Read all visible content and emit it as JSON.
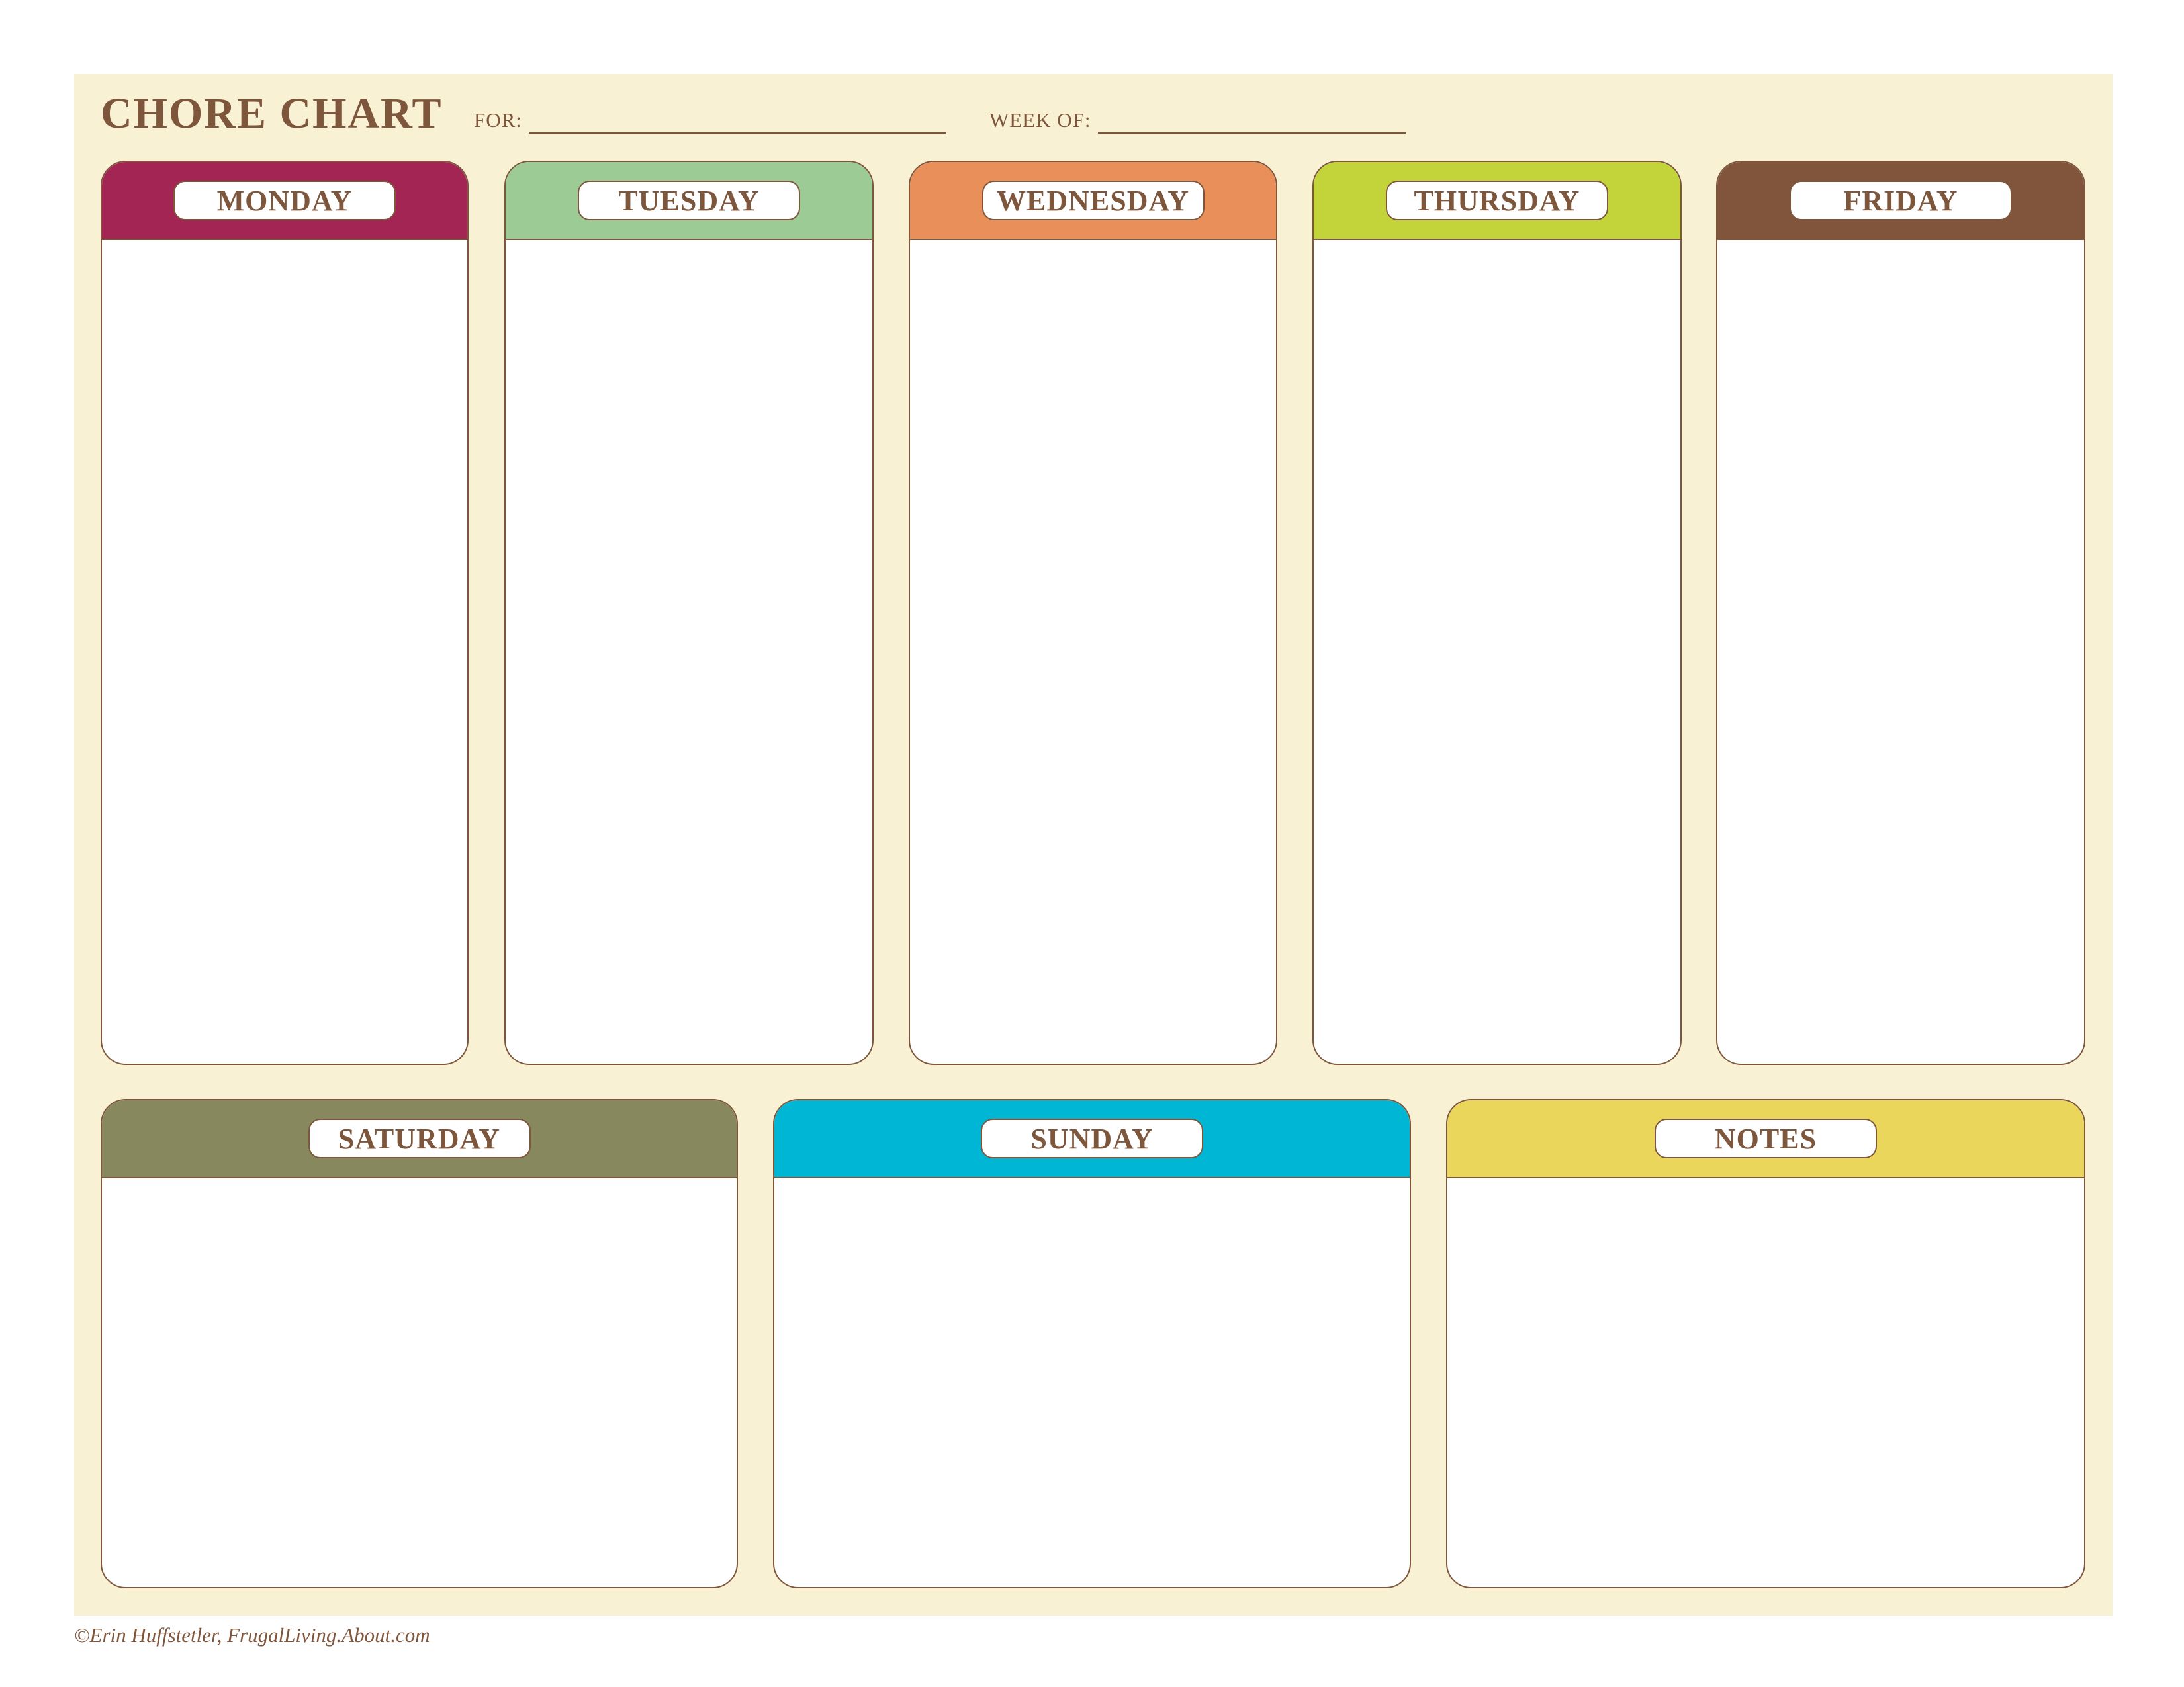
{
  "header": {
    "title": "CHORE CHART",
    "for_label": "FOR:",
    "week_of_label": "WEEK OF:"
  },
  "days": [
    {
      "label": "MONDAY",
      "color": "#a32553"
    },
    {
      "label": "TUESDAY",
      "color": "#9ccb96"
    },
    {
      "label": "WEDNESDAY",
      "color": "#e98f5a"
    },
    {
      "label": "THURSDAY",
      "color": "#c3d43b"
    },
    {
      "label": "FRIDAY",
      "color": "#81543c"
    },
    {
      "label": "SATURDAY",
      "color": "#87885d"
    },
    {
      "label": "SUNDAY",
      "color": "#00b6d5"
    },
    {
      "label": "NOTES",
      "color": "#e9d65a"
    }
  ],
  "colors": {
    "background": "#f8f1d4",
    "text": "#7e563c",
    "border": "#7e563c"
  },
  "footer": {
    "credit": "©Erin Huffstetler, FrugalLiving.About.com"
  }
}
